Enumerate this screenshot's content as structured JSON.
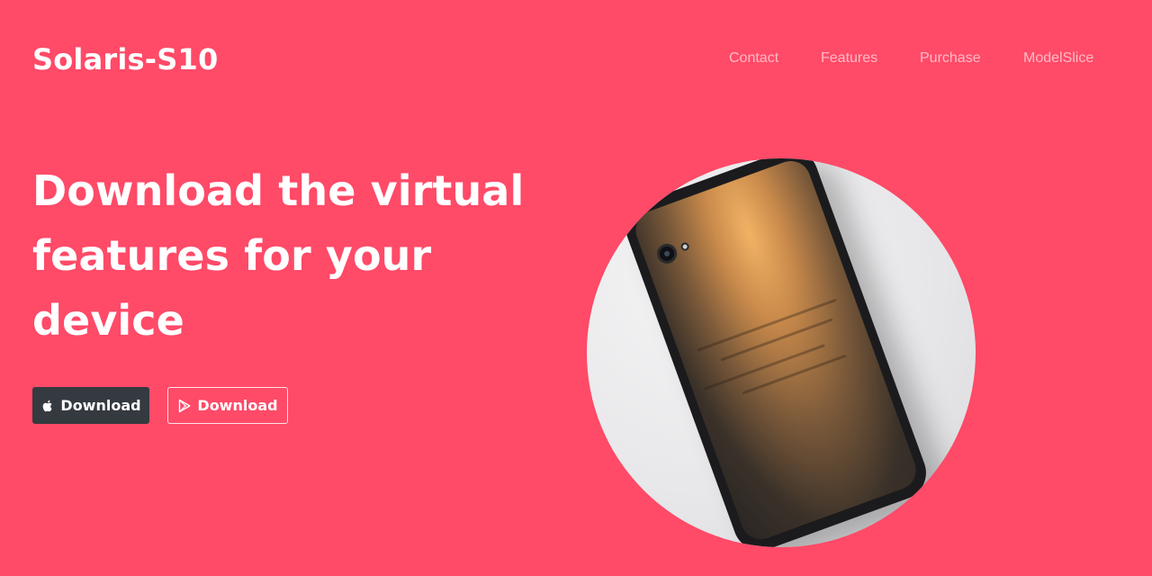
{
  "header": {
    "brand": "Solaris-S10",
    "nav": [
      {
        "label": "Contact"
      },
      {
        "label": "Features"
      },
      {
        "label": "Purchase"
      },
      {
        "label": "ModelSlice"
      }
    ]
  },
  "hero": {
    "headline_lines": [
      "Download the virtual",
      "features for your",
      "device"
    ],
    "buttons": {
      "apple_label": "Download",
      "play_label": "Download"
    },
    "icons": {
      "apple": "apple-icon",
      "play": "google-play-icon"
    },
    "image": "phone-image"
  },
  "colors": {
    "background": "#ff4a68",
    "button_dark": "#343a40",
    "text": "#ffffff"
  }
}
